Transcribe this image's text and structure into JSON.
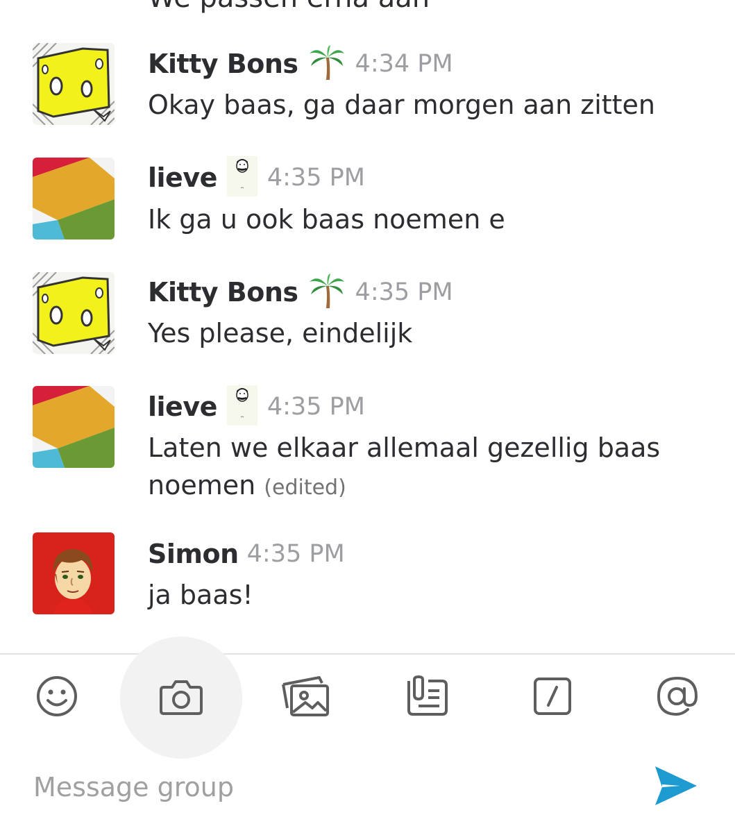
{
  "partial_message": {
    "text": "We passen erna aan"
  },
  "messages": [
    {
      "sender": "Kitty Bons",
      "status_emoji": "palm-tree-icon",
      "time": "4:34 PM",
      "text": "Okay baas, ga daar morgen aan zitten",
      "edited": ""
    },
    {
      "sender": "lieve",
      "status_emoji": "mustache-man-icon",
      "time": "4:35 PM",
      "text": "Ik ga u ook baas noemen e",
      "edited": ""
    },
    {
      "sender": "Kitty Bons",
      "status_emoji": "palm-tree-icon",
      "time": "4:35 PM",
      "text": "Yes please, eindelijk",
      "edited": ""
    },
    {
      "sender": "lieve",
      "status_emoji": "mustache-man-icon",
      "time": "4:35 PM",
      "text": "Laten we elkaar allemaal gezellig baas noemen",
      "edited": "(edited)"
    },
    {
      "sender": "Simon",
      "status_emoji": "",
      "time": "4:35 PM",
      "text": "ja baas!",
      "edited": ""
    }
  ],
  "toolbar": {
    "icons": [
      "emoji-icon",
      "camera-icon",
      "photo-gallery-icon",
      "file-icon",
      "slash-command-icon",
      "mention-icon"
    ]
  },
  "composer": {
    "placeholder": "Message group",
    "value": ""
  },
  "colors": {
    "send": "#1d9bd1",
    "timestamp": "#9c9ea1",
    "text": "#2c2d30",
    "icon": "#5e5e60"
  }
}
